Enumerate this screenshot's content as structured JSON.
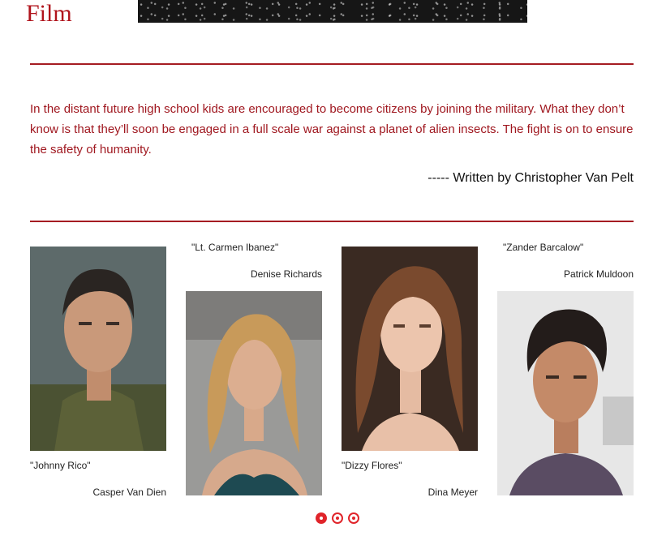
{
  "header": {
    "brand": "Film"
  },
  "synopsis": {
    "text": "In the distant future high school kids are encouraged to become citizens by joining the military. What they don’t know is that they’ll soon be engaged in a full scale war against a planet of alien insects. The fight is on to ensure the safety of humanity.",
    "byline": "----- Written by Christopher Van Pelt"
  },
  "cast": [
    {
      "role": "\"Johnny Rico\"",
      "actor": "Casper Van Dien"
    },
    {
      "role": "\"Lt. Carmen Ibanez\"",
      "actor": "Denise Richards"
    },
    {
      "role": "\"Dizzy Flores\"",
      "actor": "Dina Meyer"
    },
    {
      "role": "\"Zander Barcalow\"",
      "actor": "Patrick Muldoon"
    }
  ],
  "carousel": {
    "page_count": 3,
    "active_index": 0
  },
  "colors": {
    "accent": "#a51c22",
    "dot": "#e0242a"
  }
}
